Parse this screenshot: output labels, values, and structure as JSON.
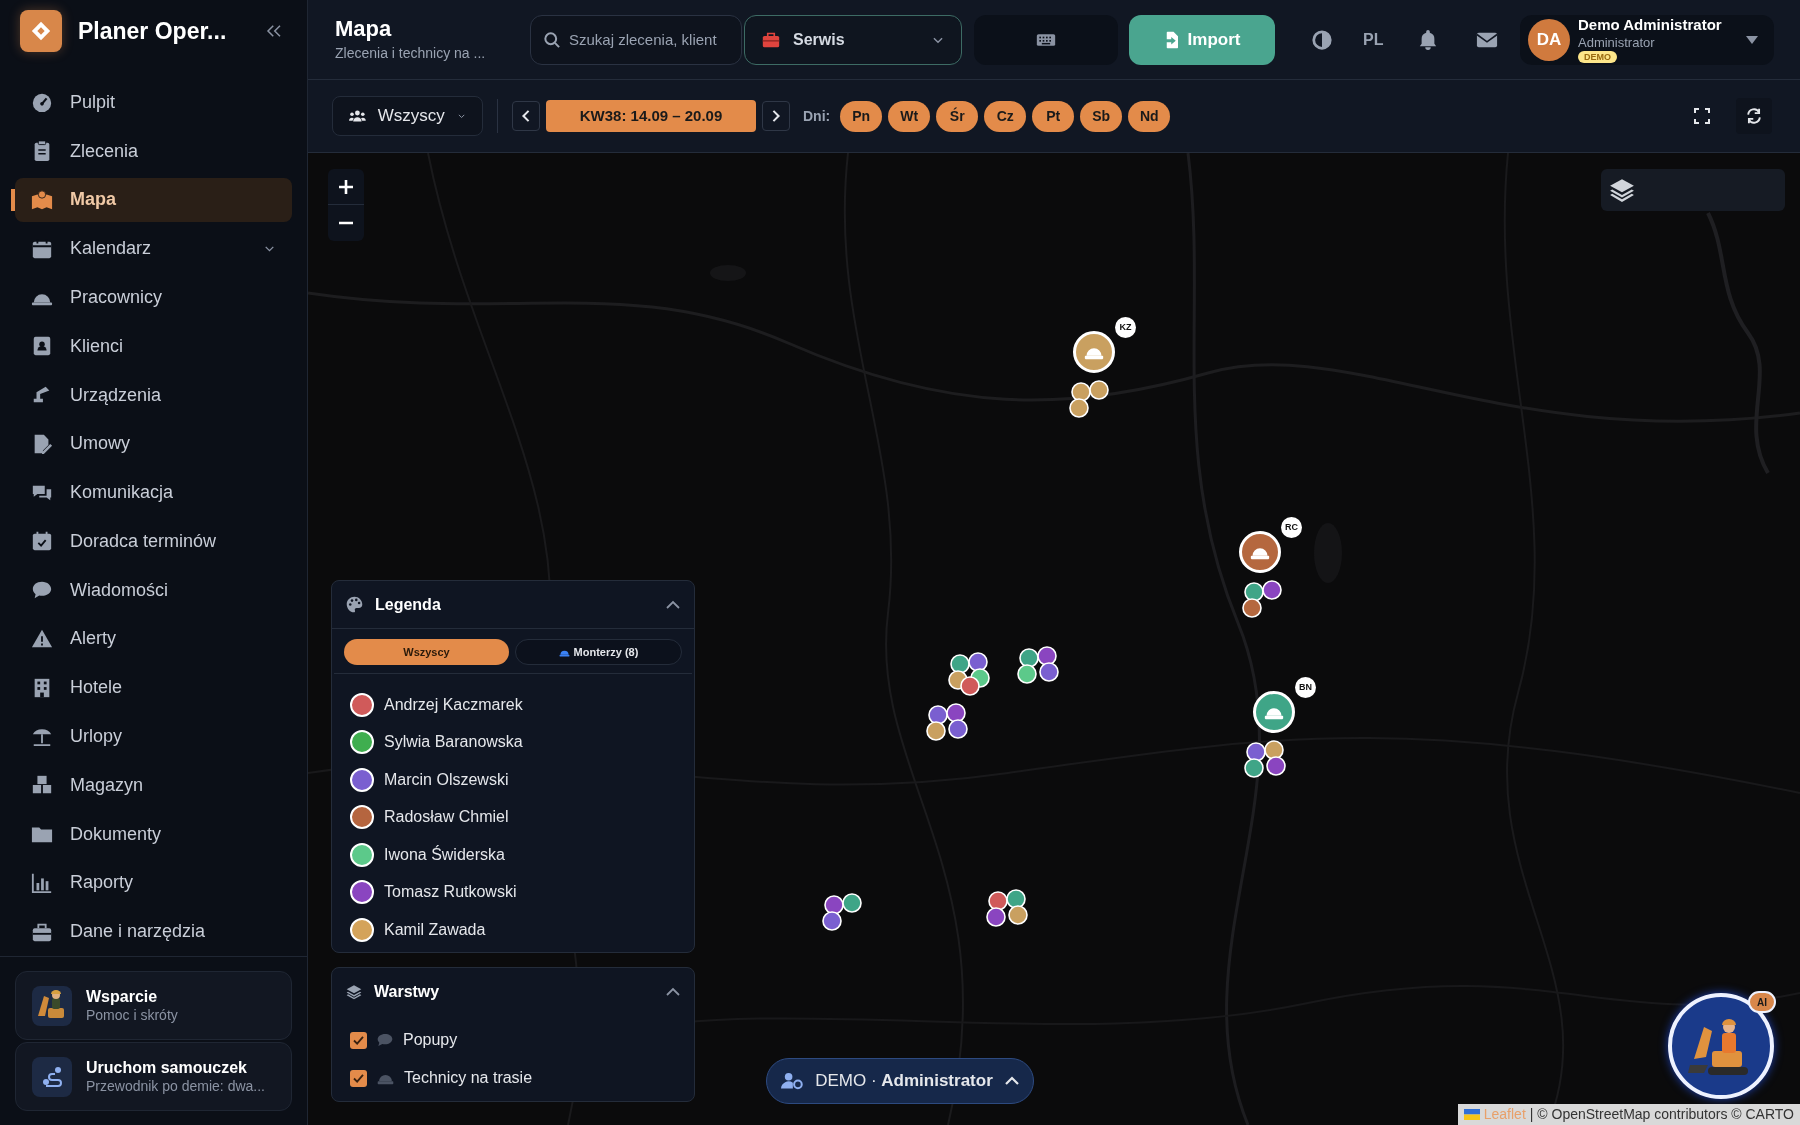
{
  "app": {
    "title": "Planer Oper..."
  },
  "sidebar": {
    "items": [
      {
        "label": "Pulpit",
        "selected": false,
        "has_submenu": false
      },
      {
        "label": "Zlecenia",
        "selected": false,
        "has_submenu": false
      },
      {
        "label": "Mapa",
        "selected": true,
        "has_submenu": false
      },
      {
        "label": "Kalendarz",
        "selected": false,
        "has_submenu": true
      },
      {
        "label": "Pracownicy",
        "selected": false,
        "has_submenu": false
      },
      {
        "label": "Klienci",
        "selected": false,
        "has_submenu": false
      },
      {
        "label": "Urządzenia",
        "selected": false,
        "has_submenu": false
      },
      {
        "label": "Umowy",
        "selected": false,
        "has_submenu": false
      },
      {
        "label": "Komunikacja",
        "selected": false,
        "has_submenu": false
      },
      {
        "label": "Doradca terminów",
        "selected": false,
        "has_submenu": false
      },
      {
        "label": "Wiadomości",
        "selected": false,
        "has_submenu": false
      },
      {
        "label": "Alerty",
        "selected": false,
        "has_submenu": false
      },
      {
        "label": "Hotele",
        "selected": false,
        "has_submenu": false
      },
      {
        "label": "Urlopy",
        "selected": false,
        "has_submenu": false
      },
      {
        "label": "Magazyn",
        "selected": false,
        "has_submenu": false
      },
      {
        "label": "Dokumenty",
        "selected": false,
        "has_submenu": false
      },
      {
        "label": "Raporty",
        "selected": false,
        "has_submenu": false
      },
      {
        "label": "Dane i narzędzia",
        "selected": false,
        "has_submenu": false
      }
    ],
    "cards": [
      {
        "title": "Wsparcie",
        "subtitle": "Pomoc i skróty"
      },
      {
        "title": "Uruchom samouczek",
        "subtitle": "Przewodnik po demie: dwa..."
      }
    ]
  },
  "header": {
    "title": "Mapa",
    "subtitle": "Zlecenia i technicy na ...",
    "search": {
      "placeholder": "Szukaj zlecenia, klient"
    },
    "mode_select": {
      "value": "Serwis"
    },
    "import_button": "Import",
    "language": "PL",
    "user": {
      "initials": "DA",
      "name": "Demo Administrator",
      "role": "Administrator",
      "badge": "DEMO"
    }
  },
  "toolbar": {
    "filter": "Wszyscy",
    "week": "KW38: 14.09 – 20.09",
    "days_label": "Dni:",
    "days": [
      {
        "label": "Pn",
        "selected": true
      },
      {
        "label": "Wt",
        "selected": true
      },
      {
        "label": "Śr",
        "selected": true
      },
      {
        "label": "Cz",
        "selected": true
      },
      {
        "label": "Pt",
        "selected": true
      },
      {
        "label": "Sb",
        "selected": true
      },
      {
        "label": "Nd",
        "selected": true
      }
    ]
  },
  "legend": {
    "title": "Legenda",
    "tabs": [
      {
        "label": "Wszyscy",
        "selected": true
      },
      {
        "label": "Monterzy (8)",
        "selected": false
      }
    ],
    "technicians": [
      {
        "name": "Andrzej Kaczmarek",
        "color": "#d05a5a"
      },
      {
        "name": "Sylwia Baranowska",
        "color": "#3fae4f"
      },
      {
        "name": "Marcin Olszewski",
        "color": "#7a5fd0"
      },
      {
        "name": "Radosław Chmiel",
        "color": "#b5653f"
      },
      {
        "name": "Iwona Świderska",
        "color": "#5cc98a"
      },
      {
        "name": "Tomasz Rutkowski",
        "color": "#8a45c0"
      },
      {
        "name": "Kamil Zawada",
        "color": "#d4a35a"
      }
    ]
  },
  "layers": {
    "title": "Warstwy",
    "items": [
      {
        "label": "Popupy",
        "checked": true
      },
      {
        "label": "Technicy na trasie",
        "checked": true
      }
    ]
  },
  "map": {
    "technicians": [
      {
        "initials": "KZ",
        "color": "#c9a060"
      },
      {
        "initials": "RC",
        "color": "#b5683f"
      },
      {
        "initials": "BN",
        "color": "#3fa587"
      }
    ]
  },
  "demo_pill": {
    "text": "DEMO · **Administrator**"
  },
  "assistant": {
    "badge": "AI"
  },
  "attribution": {
    "link": "Leaflet",
    "text": "| © OpenStreetMap contributors © CARTO"
  }
}
